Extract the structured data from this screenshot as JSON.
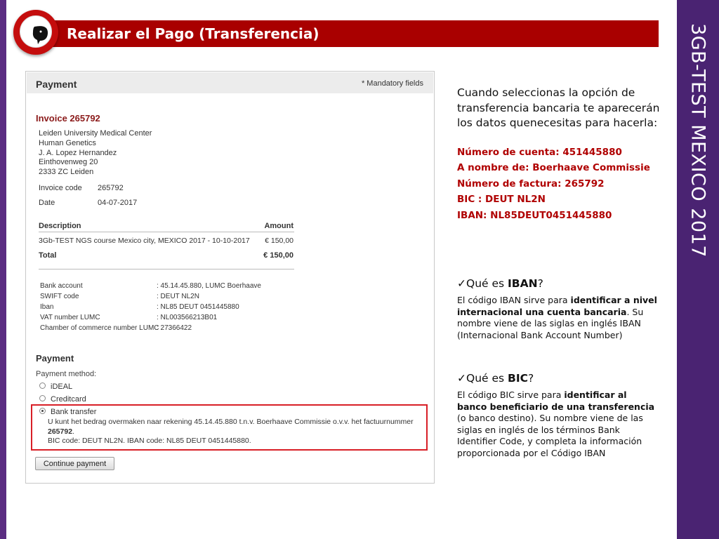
{
  "slide": {
    "title": "Realizar el Pago (Transferencia)",
    "side_title": "3GB-TEST MEXICO 2017",
    "badge_icon": "speech-bubble-icon",
    "colors": {
      "banner": "#a90000",
      "side_bar": "#4a2372",
      "accent_text": "#b00000"
    }
  },
  "form": {
    "payment_header": "Payment",
    "mandatory": "* Mandatory fields",
    "invoice_title": "Invoice 265792",
    "address": [
      "Leiden University Medical Center",
      "Human Genetics",
      "J. A. Lopez Hernandez",
      "Einthovenweg 20",
      "2333 ZC Leiden"
    ],
    "invoice_code_label": "Invoice code",
    "invoice_code_value": "265792",
    "date_label": "Date",
    "date_value": "04-07-2017",
    "desc_header": "Description",
    "amount_header": "Amount",
    "line_desc": "3Gb-TEST NGS course Mexico city, MEXICO 2017 - 10-10-2017",
    "line_amount": "€ 150,00",
    "total_label": "Total",
    "total_amount": "€ 150,00",
    "bank": [
      {
        "label": "Bank account",
        "value": ": 45.14.45.880, LUMC Boerhaave"
      },
      {
        "label": "SWIFT code",
        "value": ": DEUT NL2N"
      },
      {
        "label": "Iban",
        "value": ": NL85 DEUT 0451445880"
      },
      {
        "label": "VAT number LUMC",
        "value": ": NL003566213B01"
      },
      {
        "label": "Chamber of commerce number LUMC",
        "value": ": 27366422"
      }
    ],
    "payment_section": "Payment",
    "payment_method_label": "Payment method:",
    "methods": [
      "iDEAL",
      "Creditcard",
      "Bank transfer"
    ],
    "selected_method": "Bank transfer",
    "bt_line1": "U kunt het bedrag overmaken naar rekening 45.14.45.880 t.n.v. Boerhaave Commissie o.v.v. het factuurnummer",
    "bt_line2": "265792",
    "bt_line2_suffix": ".",
    "bt_line3": "BIC code: DEUT NL2N. IBAN code: NL85 DEUT 0451445880.",
    "continue_button": "Continue payment"
  },
  "explanation": {
    "intro": "Cuando seleccionas la opción de transferencia bancaria te aparecerán los datos quenecesitas para hacerla:",
    "details": [
      "Número de cuenta: 451445880",
      "A nombre de: Boerhaave Commissie",
      "Número de factura: 265792",
      "BIC :  DEUT NL2N",
      "IBAN: NL85DEUT0451445880"
    ],
    "iban_q_prefix": "Qué es ",
    "iban_q_term": "IBAN",
    "iban_q_suffix": "?",
    "iban_a": {
      "p1": " El código IBAN sirve para ",
      "b1": "identificar a nivel internacional una cuenta bancaria",
      "p2": ". Su nombre viene de las siglas en inglés IBAN (Internacional Bank Account Number)"
    },
    "bic_q_prefix": "Qué es ",
    "bic_q_term": "BIC",
    "bic_q_suffix": "?",
    "bic_a": {
      "p1": " El código BIC sirve para ",
      "b1": "identificar al banco beneficiario de una transferencia",
      "p2": " (o banco destino). Su nombre viene de las siglas en inglés de los términos Bank Identifier Code, y completa la información proporcionada por el Código IBAN"
    }
  }
}
